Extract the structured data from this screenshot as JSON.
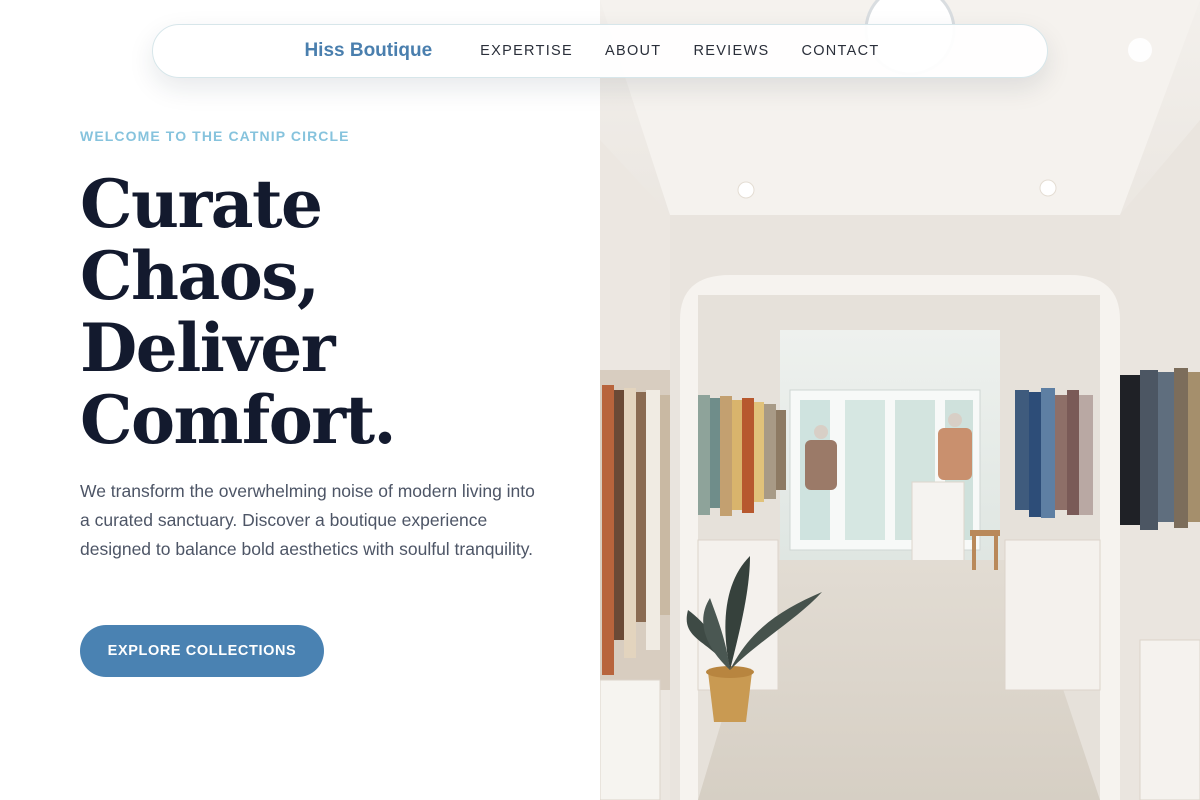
{
  "nav": {
    "brand": "Hiss Boutique",
    "links": [
      "EXPERTISE",
      "ABOUT",
      "REVIEWS",
      "CONTACT"
    ]
  },
  "hero": {
    "eyebrow": "WELCOME TO THE CATNIP CIRCLE",
    "headline_lines": [
      "Curate",
      "Chaos,",
      "Deliver",
      "Comfort."
    ],
    "body": "We transform the overwhelming noise of modern living into a curated sanctuary. Discover a boutique experience designed to balance bold aesthetics with soulful tranquility.",
    "cta_label": "EXPLORE COLLECTIONS"
  },
  "colors": {
    "accent": "#4a82b2",
    "brand_text": "#4a7fae",
    "eyebrow": "#86c3dd",
    "headline": "#131a2e",
    "body_text": "#4d5566"
  },
  "photo": {
    "subject": "boutique-interior-photo"
  }
}
